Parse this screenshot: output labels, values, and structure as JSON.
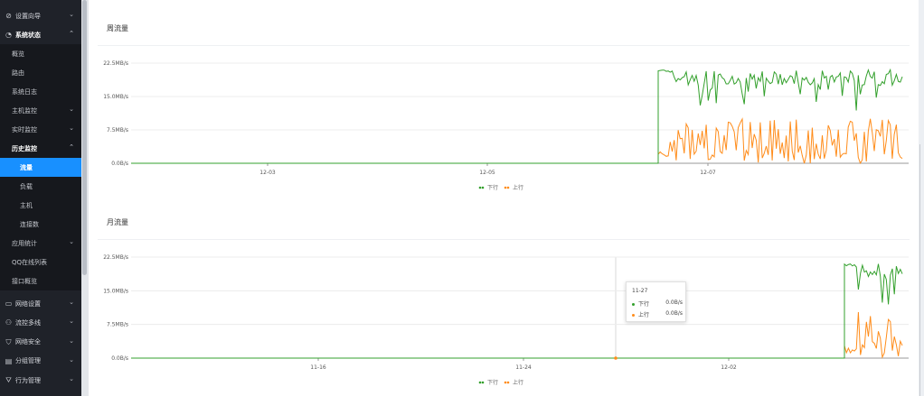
{
  "sidebar": {
    "items": [
      {
        "label": "设置向导",
        "icon": "compass-icon",
        "chevron": "down"
      },
      {
        "label": "系统状态",
        "icon": "dashboard-icon",
        "chevron": "up"
      },
      {
        "label": "概览"
      },
      {
        "label": "路由"
      },
      {
        "label": "系统日志"
      },
      {
        "label": "主机监控",
        "chevron": "down"
      },
      {
        "label": "实时监控",
        "chevron": "down"
      },
      {
        "label": "历史监控",
        "chevron": "up"
      },
      {
        "label": "流量",
        "active": true
      },
      {
        "label": "负载"
      },
      {
        "label": "主机"
      },
      {
        "label": "连接数"
      },
      {
        "label": "应用统计",
        "chevron": "down"
      },
      {
        "label": "QQ在线列表"
      },
      {
        "label": "接口概览"
      },
      {
        "label": "网络设置",
        "icon": "monitor-icon",
        "chevron": "down"
      },
      {
        "label": "流控多线",
        "icon": "users-icon",
        "chevron": "down"
      },
      {
        "label": "网络安全",
        "icon": "shield-icon",
        "chevron": "down"
      },
      {
        "label": "分组管理",
        "icon": "document-icon",
        "chevron": "down"
      },
      {
        "label": "行为管理",
        "icon": "filter-icon",
        "chevron": "down"
      }
    ]
  },
  "weekly": {
    "title": "周流量"
  },
  "monthly": {
    "title": "月流量"
  },
  "tooltip": {
    "date": "11-27",
    "rows": [
      {
        "name": "下行",
        "value": "0.0B/s",
        "color": "#33a02c"
      },
      {
        "name": "上行",
        "value": "0.0B/s",
        "color": "#ff8c1a"
      }
    ]
  },
  "colors": {
    "down": "#33a02c",
    "up": "#ff8c1a",
    "accent": "#1890ff"
  },
  "chart_data": [
    {
      "type": "line",
      "title": "周流量",
      "y_ticks": [
        "22.5MB/s",
        "15.0MB/s",
        "7.5MB/s",
        "0.0B/s"
      ],
      "ylim": [
        0,
        22.5
      ],
      "x_ticks": [
        "12-03",
        "12-05",
        "12-07"
      ],
      "legend": "bottom-center",
      "series": [
        {
          "name": "下行",
          "note": "0 until ~12-06 evening, then ~13-21 MB/s",
          "peak": 21
        },
        {
          "name": "上行",
          "note": "0 until ~12-06 evening, then ~0-10 MB/s",
          "peak": 10
        }
      ]
    },
    {
      "type": "line",
      "title": "月流量",
      "y_ticks": [
        "22.5MB/s",
        "15.0MB/s",
        "7.5MB/s",
        "0.0B/s"
      ],
      "ylim": [
        0,
        22.5
      ],
      "x_ticks": [
        "11-16",
        "11-24",
        "12-02"
      ],
      "legend": "bottom-center",
      "series": [
        {
          "name": "下行",
          "note": "0 until ~12-06, then ~12-21 MB/s",
          "peak": 21
        },
        {
          "name": "上行",
          "note": "0 until ~12-06, then ~0-11 MB/s",
          "peak": 11
        }
      ]
    }
  ]
}
